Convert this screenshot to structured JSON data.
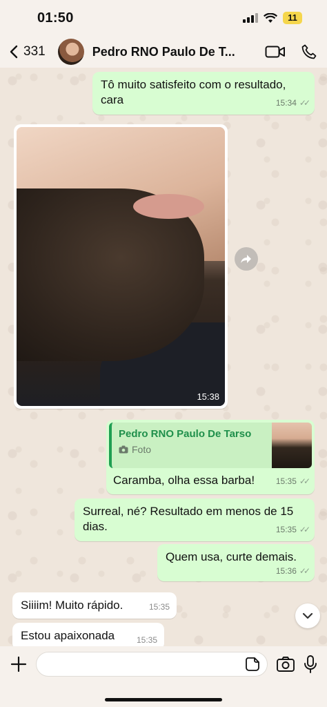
{
  "status": {
    "time": "01:50",
    "battery": "11"
  },
  "header": {
    "back_count": "331",
    "contact_name": "Pedro RNO Paulo De T..."
  },
  "messages": {
    "m1": {
      "text": "Tô muito satisfeito com o resultado, cara",
      "time": "15:34"
    },
    "photo": {
      "time": "15:38"
    },
    "m2": {
      "quote_name": "Pedro RNO Paulo De Tarso",
      "quote_type": "Foto",
      "text": "Caramba, olha essa barba!",
      "time": "15:35"
    },
    "m3": {
      "text": "Surreal, né? Resultado em menos de 15 dias.",
      "time": "15:35"
    },
    "m4": {
      "text": "Quem usa, curte demais.",
      "time": "15:36"
    },
    "m5": {
      "text": "Siiiim! Muito rápido.",
      "time": "15:35"
    },
    "m6": {
      "text": "Estou apaixonada",
      "time": "15:35"
    }
  },
  "composer": {
    "placeholder": ""
  },
  "icons": [
    "back-chevron-icon",
    "video-call-icon",
    "phone-icon",
    "forward-icon",
    "chevron-down-icon",
    "plus-icon",
    "sticker-icon",
    "camera-icon",
    "microphone-icon",
    "camera-small-icon"
  ],
  "colors": {
    "outgoing_bubble": "#d8fdd2",
    "incoming_bubble": "#ffffff",
    "accent_green": "#1f9e52"
  }
}
